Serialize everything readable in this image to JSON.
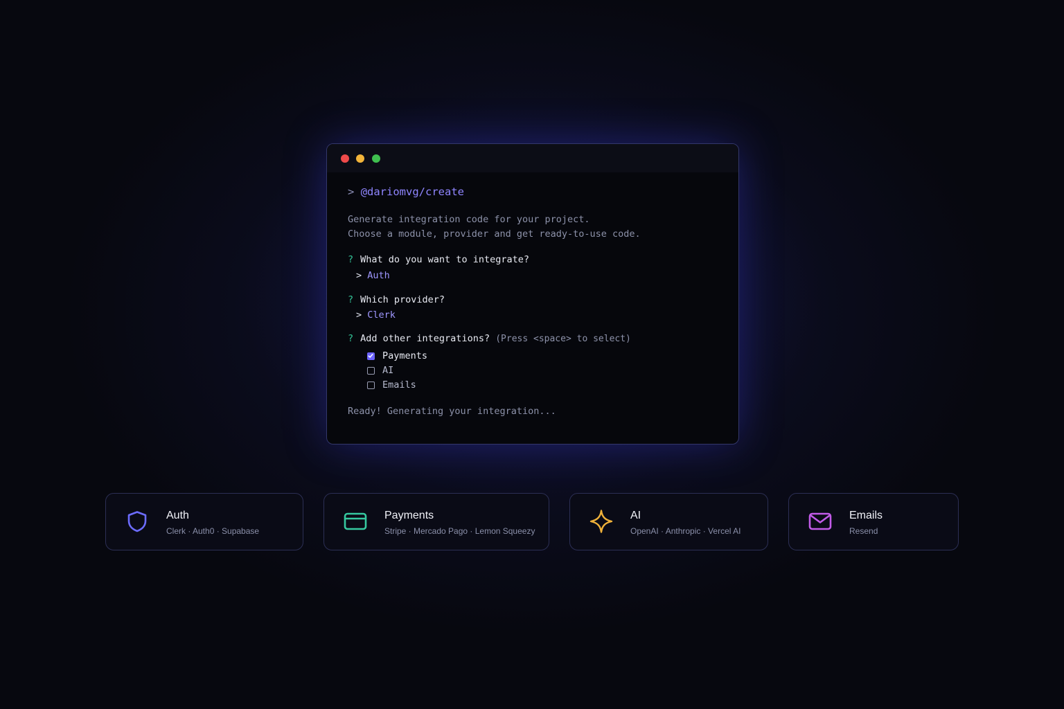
{
  "terminal": {
    "prompt_caret": ">",
    "command": "@dariomvg/create",
    "description_line1": "Generate integration code for your project.",
    "description_line2": "Choose a module, provider and get ready-to-use code.",
    "questions": [
      {
        "mark": "?",
        "text": "What do you want to integrate?",
        "answer_caret": ">",
        "answer": "Auth"
      },
      {
        "mark": "?",
        "text": "Which provider?",
        "answer_caret": ">",
        "answer": "Clerk"
      },
      {
        "mark": "?",
        "text": "Add other integrations?",
        "hint": "(Press <space> to select)"
      }
    ],
    "options": [
      {
        "label": "Payments",
        "checked": true
      },
      {
        "label": "AI",
        "checked": false
      },
      {
        "label": "Emails",
        "checked": false
      }
    ],
    "status": "Ready! Generating your integration...",
    "colors": {
      "dot_red": "#ef4a4a",
      "dot_yellow": "#f2b43a",
      "dot_green": "#3fbf4f",
      "accent": "#8f85ff",
      "question_mark": "#34c79a"
    }
  },
  "cards": [
    {
      "title": "Auth",
      "subtitle": "Clerk · Auth0 · Supabase",
      "icon": "shield-icon",
      "color": "#6c6cff"
    },
    {
      "title": "Payments",
      "subtitle": "Stripe · Mercado Pago · Lemon Squeezy",
      "icon": "credit-card-icon",
      "color": "#36c9a0"
    },
    {
      "title": "AI",
      "subtitle": "OpenAI · Anthropic · Vercel AI",
      "icon": "sparkle-icon",
      "color": "#f0b23a"
    },
    {
      "title": "Emails",
      "subtitle": "Resend",
      "icon": "mail-icon",
      "color": "#c25be8"
    }
  ]
}
